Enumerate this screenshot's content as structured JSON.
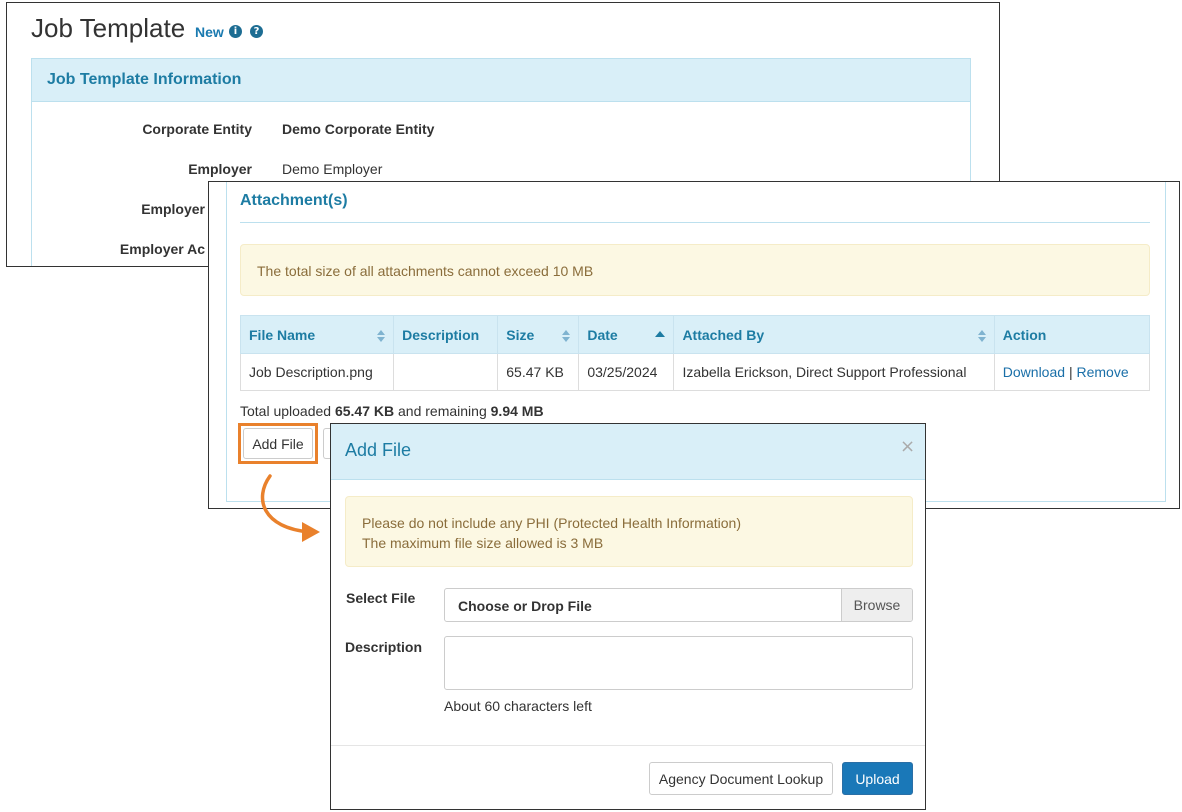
{
  "job_template": {
    "title": "Job Template",
    "status": "New",
    "info_icon": "info-circle-icon",
    "help_icon": "question-circle-icon",
    "section_title": "Job Template Information",
    "fields": [
      {
        "label": "Corporate Entity",
        "value": "Demo Corporate Entity"
      },
      {
        "label": "Employer",
        "value": "Demo Employer"
      },
      {
        "label": "Employer",
        "value": ""
      },
      {
        "label": "Employer Ac",
        "value": ""
      }
    ]
  },
  "attachments": {
    "title": "Attachment(s)",
    "alert": "The total size of all attachments cannot exceed 10 MB",
    "columns": [
      "File Name",
      "Description",
      "Size",
      "Date",
      "Attached By",
      "Action"
    ],
    "rows": [
      {
        "file_name": "Job Description.png",
        "description": "",
        "size": "65.47 KB",
        "date": "03/25/2024",
        "attached_by": "Izabella Erickson, Direct Support Professional",
        "download_label": "Download",
        "separator": "|",
        "remove_label": "Remove"
      }
    ],
    "total_prefix": "Total uploaded",
    "total_uploaded": "65.47 KB",
    "total_mid": "and remaining",
    "remaining": "9.94 MB",
    "add_file_label": "Add File"
  },
  "modal": {
    "title": "Add File",
    "close_symbol": "×",
    "alert_line1": "Please do not include any PHI (Protected Health Information)",
    "alert_line2": "The maximum file size allowed is 3 MB",
    "select_file_label": "Select File",
    "file_placeholder": "Choose or Drop File",
    "browse_label": "Browse",
    "description_label": "Description",
    "description_value": "",
    "chars_left": "About 60 characters left",
    "lookup_label": "Agency Document Lookup",
    "upload_label": "Upload"
  },
  "colors": {
    "accent": "#1d7ca3",
    "header_bg": "#d9eff8",
    "alert_bg": "#fcf8e3",
    "alert_text": "#8a6d3b",
    "highlight": "#e9812c",
    "primary_button": "#1a78b8"
  }
}
